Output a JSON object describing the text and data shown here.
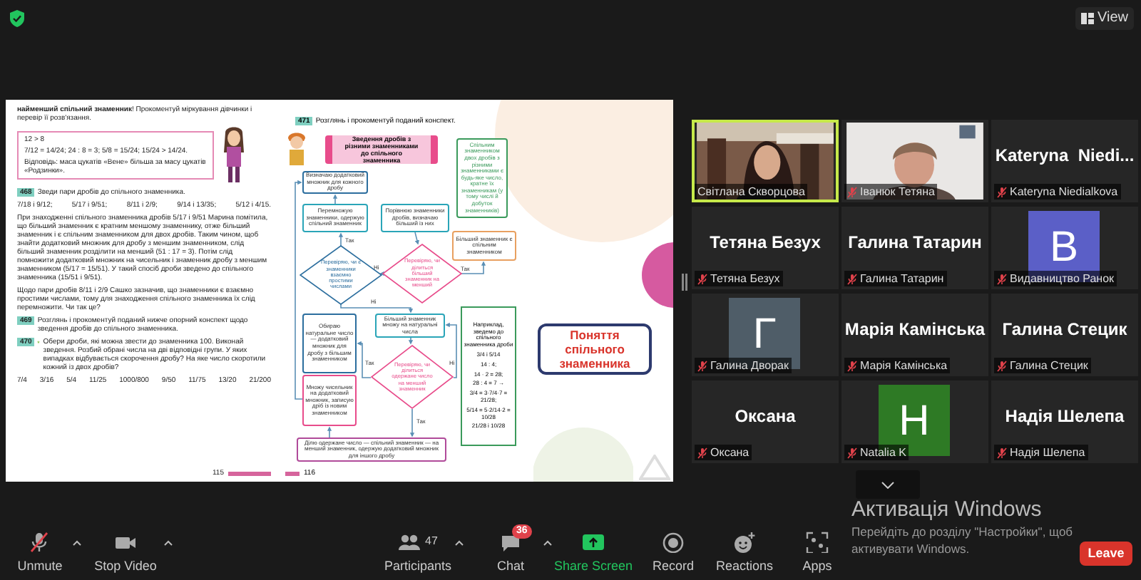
{
  "top_bar": {
    "view_button": "View"
  },
  "shared_screen": {
    "left_page": {
      "intro": "**найменший спільний знаменник**! Прокоментуй міркування дівчинки і перевір її розв'язання.",
      "worked_lines": [
        "12 > 8",
        "7/12 = 14/24;   24 : 8 = 3;   5/8 = 15/24;   15/24 > 14/24.",
        "Відповідь: маса цукатів «Вене» більша за масу цукатів «Родзинки»."
      ],
      "ex468": {
        "number": "468",
        "text": "Зведи пари дробів до спільного знаменника."
      },
      "fractions_468": [
        "7/18 і 9/12;",
        "5/17 і 9/51;",
        "8/11 і 2/9;",
        "9/14 і 13/35;",
        "5/12 і 4/15."
      ],
      "paragraph_1": "При знаходженні спільного знаменника дробів 5/17 і 9/51 Марина помітила, що більший знаменник є кратним меншому знаменнику, отже більший знаменник і є спільним знаменником для двох дробів. Таким чином, щоб знайти додатковий множник для дробу з меншим знаменником, слід більший знаменник розділити на менший (51 : 17 = 3). Потім слід помножити додатковий множник на чисельник і знаменник дробу з меншим знаменником (5/17 = 15/51). У такий спосіб дроби зведено до спільного знаменника (15/51 і 9/51).",
      "paragraph_2": "Щодо пари дробів 8/11 і 2/9 Сашко зазначив, що знаменники є взаємно простими числами, тому для знаходження спільного знаменника їх слід перемножити. Чи так це?",
      "ex469": {
        "number": "469",
        "text": "Розглянь і прокоментуй поданий нижче опорний конспект щодо зведення дробів до спільного знаменника."
      },
      "ex470": {
        "number": "470",
        "text": "Обери дроби, які можна звести до знаменника 100. Виконай зведення. Розбий обрані числа на дві відповідні групи. У яких випадках відбувається скорочення дробу? На яке число скоротили кожний із двох дробів?"
      },
      "fractions_470": [
        "7/4",
        "3/16",
        "5/4",
        "11/25",
        "1000/800",
        "9/50",
        "11/75",
        "13/20",
        "21/200"
      ],
      "page_number": "115"
    },
    "right_page": {
      "ex471": {
        "number": "471",
        "text": "Розглянь і прокоментуй поданий конспект."
      },
      "nodes": [
        {
          "kind": "header",
          "color": "#e84c8b",
          "text": "Зведення дробів з різними знаменниками до спільного знаменника"
        },
        {
          "kind": "note",
          "color": "#3a9a5b",
          "text": "Спільним знаменником двох дробів з різними знаменниками є будь-яке число, кратне їх знаменникам (у тому числі й добуток знаменників)"
        },
        {
          "kind": "box",
          "color": "#2c6e9e",
          "text": "Визначаю додатковий множник для кожного дробу"
        },
        {
          "kind": "box",
          "color": "#2aa5b8",
          "text": "Перемножую знаменники, одержую спільний знаменник"
        },
        {
          "kind": "box",
          "color": "#2aa5b8",
          "text": "Порівнюю знаменники дробів, визначаю більший із них"
        },
        {
          "kind": "box",
          "color": "#e8a060",
          "text": "Більший знаменник є спільним знаменником"
        },
        {
          "kind": "diamond",
          "color": "#2c6e9e",
          "text": "Перевіряю, чи є знаменники взаємно простими числами"
        },
        {
          "kind": "diamond",
          "color": "#e84c8b",
          "text": "Перевіряю, чи ділиться більший знаменник на менший"
        },
        {
          "kind": "box",
          "color": "#2aa5b8",
          "text": "Більший знаменник множу на натуральні числа"
        },
        {
          "kind": "box",
          "color": "#2c6e9e",
          "text": "Обираю натуральне число — додатковий множник для дробу з більшим знаменником"
        },
        {
          "kind": "box",
          "color": "#e84c8b",
          "text": "Множу чисельник на додатковий множник, записую дріб із новим знаменником"
        },
        {
          "kind": "diamond",
          "color": "#e84c8b",
          "text": "Перевіряю, чи ділиться одержане число на менший знаменник"
        },
        {
          "kind": "box",
          "color": "#b04a9a",
          "text": "Ділю одержане число — спільний знаменник — на менший знаменник, одержую додатковий множник для іншого дробу"
        },
        {
          "kind": "example",
          "color": "#3a9a5b",
          "lines": [
            "Наприклад, зведемо до спільного знаменника дроби",
            "3/4 і 5/14",
            "14 : 4;",
            "14 · 2 = 28;",
            "28 : 4 = 7 →",
            "3/4 = 3·7/4·7 = 21/28;",
            "5/14 = 5·2/14·2 = 10/28",
            "21/28 і 10/28"
          ]
        }
      ],
      "edge_labels": [
        "Так",
        "Ні",
        "Так",
        "Ні",
        "Так",
        "Ні",
        "Так"
      ],
      "page_number": "116"
    },
    "concept_box": "Поняття спільного знаменника"
  },
  "participants": [
    {
      "kind": "video",
      "label": "Світлана Скворцова",
      "muted": false,
      "speaking": true
    },
    {
      "kind": "video",
      "label": "Іванюк Тетяна",
      "muted": true,
      "speaking": false
    },
    {
      "kind": "name",
      "name": "Kateryna  Niedi...",
      "label": "Kateryna Niedialkova",
      "muted": true,
      "speaking": false
    },
    {
      "kind": "name",
      "name": "Тетяна Безух",
      "label": "Тетяна Безух",
      "muted": true,
      "speaking": false
    },
    {
      "kind": "name",
      "name": "Галина Татарин",
      "label": "Галина Татарин",
      "muted": true,
      "speaking": false
    },
    {
      "kind": "avatar",
      "letter": "В",
      "color": "#5b5fc7",
      "label": "Видавництво Ранок",
      "muted": true,
      "speaking": false
    },
    {
      "kind": "avatar",
      "letter": "Г",
      "color": "#4f5d68",
      "label": "Галина Дворак",
      "muted": true,
      "speaking": false
    },
    {
      "kind": "name",
      "name": "Марія Камінська",
      "label": "Марія Камінська",
      "muted": true,
      "speaking": false
    },
    {
      "kind": "name",
      "name": "Галина Стецик",
      "label": "Галина Стецик",
      "muted": true,
      "speaking": false
    },
    {
      "kind": "name",
      "name": "Оксана",
      "label": "Оксана",
      "muted": true,
      "speaking": false
    },
    {
      "kind": "avatar",
      "letter": "Н",
      "color": "#2e7a25",
      "label": "Natalia K",
      "muted": true,
      "speaking": false
    },
    {
      "kind": "name",
      "name": "Надія Шелепа",
      "label": "Надія Шелепа",
      "muted": true,
      "speaking": false
    }
  ],
  "activation_notice": {
    "title": "Активація Windows",
    "text": "Перейдіть до розділу \"Настройки\", щоб активувати Windows."
  },
  "toolbar": [
    {
      "kind": "mic",
      "label": "Unmute",
      "caret": true
    },
    {
      "kind": "video",
      "label": "Stop Video",
      "caret": true
    },
    {
      "kind": "participants",
      "label": "Participants",
      "count": "47",
      "caret": true
    },
    {
      "kind": "chat",
      "label": "Chat",
      "badge": "36",
      "caret": true
    },
    {
      "kind": "share",
      "label": "Share Screen",
      "caret": false
    },
    {
      "kind": "record",
      "label": "Record",
      "caret": false
    },
    {
      "kind": "reactions",
      "label": "Reactions",
      "caret": false
    },
    {
      "kind": "apps",
      "label": "Apps",
      "caret": false
    }
  ],
  "leave_button": "Leave"
}
